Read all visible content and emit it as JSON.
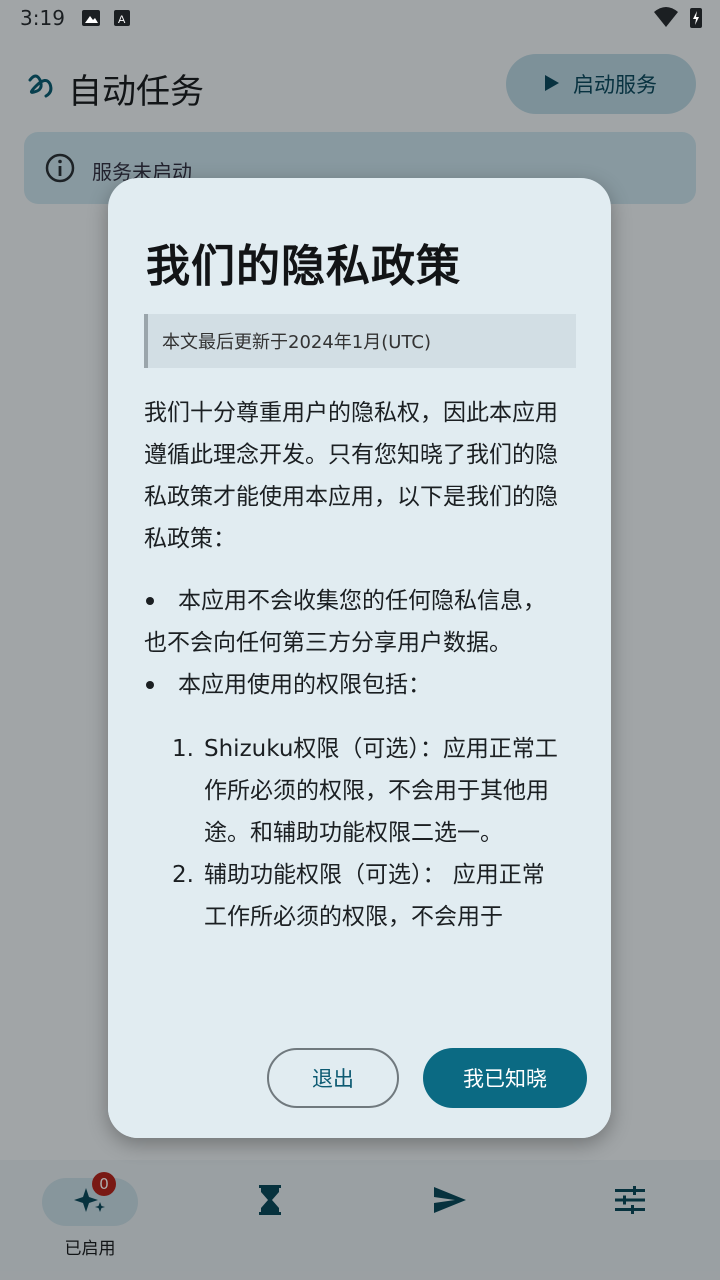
{
  "status_bar": {
    "time": "3:19"
  },
  "app_bar": {
    "title": "自动任务",
    "start_button": "启动服务"
  },
  "status_card": {
    "text": "服务未启动"
  },
  "dialog": {
    "title": "我们的隐私政策",
    "note": "本文最后更新于2024年1月(UTC)",
    "intro": "我们十分尊重用户的隐私权，因此本应用遵循此理念开发。只有您知晓了我们的隐私政策才能使用本应用，以下是我们的隐私政策：",
    "bullets": [
      "本应用不会收集您的任何隐私信息，也不会向任何第三方分享用户数据。",
      "本应用使用的权限包括："
    ],
    "permissions": [
      {
        "num": "1.",
        "text": "Shizuku权限（可选）：应用正常工作所必须的权限，不会用于其他用途。和辅助功能权限二选一。"
      },
      {
        "num": "2.",
        "text": "辅助功能权限（可选）： 应用正常工作所必须的权限，不会用于"
      }
    ],
    "exit_button": "退出",
    "ok_button": "我已知晓"
  },
  "bottom_nav": {
    "items": [
      {
        "label": "已启用",
        "icon": "sparkle-icon",
        "badge": "0",
        "active": true
      },
      {
        "label": "",
        "icon": "hourglass-icon"
      },
      {
        "label": "",
        "icon": "send-icon"
      },
      {
        "label": "",
        "icon": "tune-icon"
      }
    ]
  }
}
